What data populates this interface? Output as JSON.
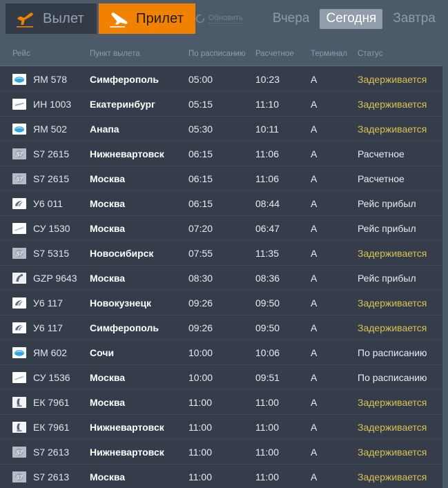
{
  "header": {
    "tabs": [
      {
        "id": "departures",
        "label": "Вылет",
        "icon": "plane-takeoff-icon",
        "active": false
      },
      {
        "id": "arrivals",
        "label": "Прилет",
        "icon": "plane-landing-icon",
        "active": true
      }
    ],
    "refresh": {
      "label": "Обновить",
      "icon": "refresh-icon"
    },
    "days": [
      {
        "id": "yesterday",
        "label": "Вчера",
        "active": false
      },
      {
        "id": "today",
        "label": "Сегодня",
        "active": true
      },
      {
        "id": "tomorrow",
        "label": "Завтра",
        "active": false
      }
    ]
  },
  "colors": {
    "accent_orange": "#f28100",
    "page_bg": "#4c5a6a",
    "table_bg": "#343d49",
    "status_delayed": "#d8c351",
    "status_normal": "#e7edf3"
  },
  "table": {
    "columns": [
      {
        "key": "flight",
        "label": "Рейс"
      },
      {
        "key": "city",
        "label": "Пункт вылета"
      },
      {
        "key": "sched",
        "label": "По расписанию"
      },
      {
        "key": "est",
        "label": "Расчетное"
      },
      {
        "key": "term",
        "label": "Терминал"
      },
      {
        "key": "status",
        "label": "Статус"
      }
    ],
    "rows": [
      {
        "logo": "yamal-logo-icon",
        "flight": "ЯМ 578",
        "city": "Симферополь",
        "sched": "05:00",
        "est": "10:23",
        "term": "A",
        "status": "Задерживается",
        "status_kind": "delayed"
      },
      {
        "logo": "ikar-logo-icon",
        "flight": "ИН 1003",
        "city": "Екатеринбург",
        "sched": "05:15",
        "est": "11:10",
        "term": "A",
        "status": "Задерживается",
        "status_kind": "delayed"
      },
      {
        "logo": "yamal-logo-icon",
        "flight": "ЯМ 502",
        "city": "Анапа",
        "sched": "05:30",
        "est": "10:11",
        "term": "A",
        "status": "Задерживается",
        "status_kind": "delayed"
      },
      {
        "logo": "s7-logo-icon",
        "flight": "S7 2615",
        "city": "Нижневартовск",
        "sched": "06:15",
        "est": "11:06",
        "term": "A",
        "status": "Расчетное",
        "status_kind": "normal"
      },
      {
        "logo": "s7-logo-icon",
        "flight": "S7 2615",
        "city": "Москва",
        "sched": "06:15",
        "est": "11:06",
        "term": "A",
        "status": "Расчетное",
        "status_kind": "normal"
      },
      {
        "logo": "uralair-logo-icon",
        "flight": "У6 011",
        "city": "Москва",
        "sched": "06:15",
        "est": "08:44",
        "term": "A",
        "status": "Рейс прибыл",
        "status_kind": "normal"
      },
      {
        "logo": "aeroflot-logo-icon",
        "flight": "СУ 1530",
        "city": "Москва",
        "sched": "07:20",
        "est": "06:47",
        "term": "A",
        "status": "Рейс прибыл",
        "status_kind": "normal"
      },
      {
        "logo": "s7-logo-icon",
        "flight": "S7 5315",
        "city": "Новосибирск",
        "sched": "07:55",
        "est": "11:35",
        "term": "A",
        "status": "Задерживается",
        "status_kind": "delayed"
      },
      {
        "logo": "gazprom-logo-icon",
        "flight": "GZP 9643",
        "city": "Москва",
        "sched": "08:30",
        "est": "08:36",
        "term": "A",
        "status": "Рейс прибыл",
        "status_kind": "normal"
      },
      {
        "logo": "uralair-logo-icon",
        "flight": "У6 117",
        "city": "Новокузнецк",
        "sched": "09:26",
        "est": "09:50",
        "term": "A",
        "status": "Задерживается",
        "status_kind": "delayed"
      },
      {
        "logo": "uralair-logo-icon",
        "flight": "У6 117",
        "city": "Симферополь",
        "sched": "09:26",
        "est": "09:50",
        "term": "A",
        "status": "Задерживается",
        "status_kind": "delayed"
      },
      {
        "logo": "yamal-logo-icon",
        "flight": "ЯМ 602",
        "city": "Сочи",
        "sched": "10:00",
        "est": "10:06",
        "term": "A",
        "status": "По расписанию",
        "status_kind": "normal"
      },
      {
        "logo": "aeroflot-logo-icon",
        "flight": "СУ 1536",
        "city": "Москва",
        "sched": "10:00",
        "est": "09:51",
        "term": "A",
        "status": "По расписанию",
        "status_kind": "normal"
      },
      {
        "logo": "emirates-logo-icon",
        "flight": "ЕК 7961",
        "city": "Москва",
        "sched": "11:00",
        "est": "11:00",
        "term": "A",
        "status": "Задерживается",
        "status_kind": "delayed"
      },
      {
        "logo": "emirates-logo-icon",
        "flight": "ЕК 7961",
        "city": "Нижневартовск",
        "sched": "11:00",
        "est": "11:00",
        "term": "A",
        "status": "Задерживается",
        "status_kind": "delayed"
      },
      {
        "logo": "s7-logo-icon",
        "flight": "S7 2613",
        "city": "Нижневартовск",
        "sched": "11:00",
        "est": "11:00",
        "term": "A",
        "status": "Задерживается",
        "status_kind": "delayed"
      },
      {
        "logo": "s7-logo-icon",
        "flight": "S7 2613",
        "city": "Москва",
        "sched": "11:00",
        "est": "11:00",
        "term": "A",
        "status": "Задерживается",
        "status_kind": "delayed"
      }
    ]
  }
}
